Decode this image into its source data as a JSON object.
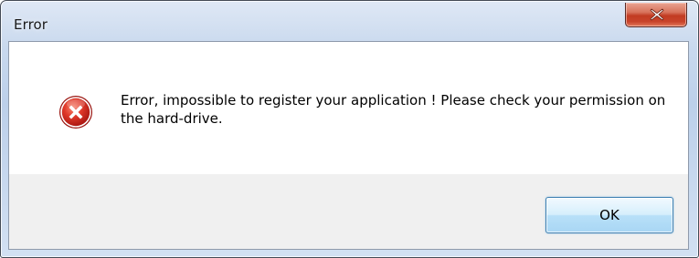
{
  "window": {
    "title": "Error"
  },
  "titlebar": {
    "close_icon": "close-icon"
  },
  "dialog": {
    "icon": "error-icon",
    "message": "Error, impossible to register your application ! Please check your permission on the hard-drive.",
    "ok_label": "OK"
  },
  "colors": {
    "close_button": "#c7452d",
    "error_icon": "#d42a1f",
    "ok_button_border": "#3c7fb1"
  }
}
